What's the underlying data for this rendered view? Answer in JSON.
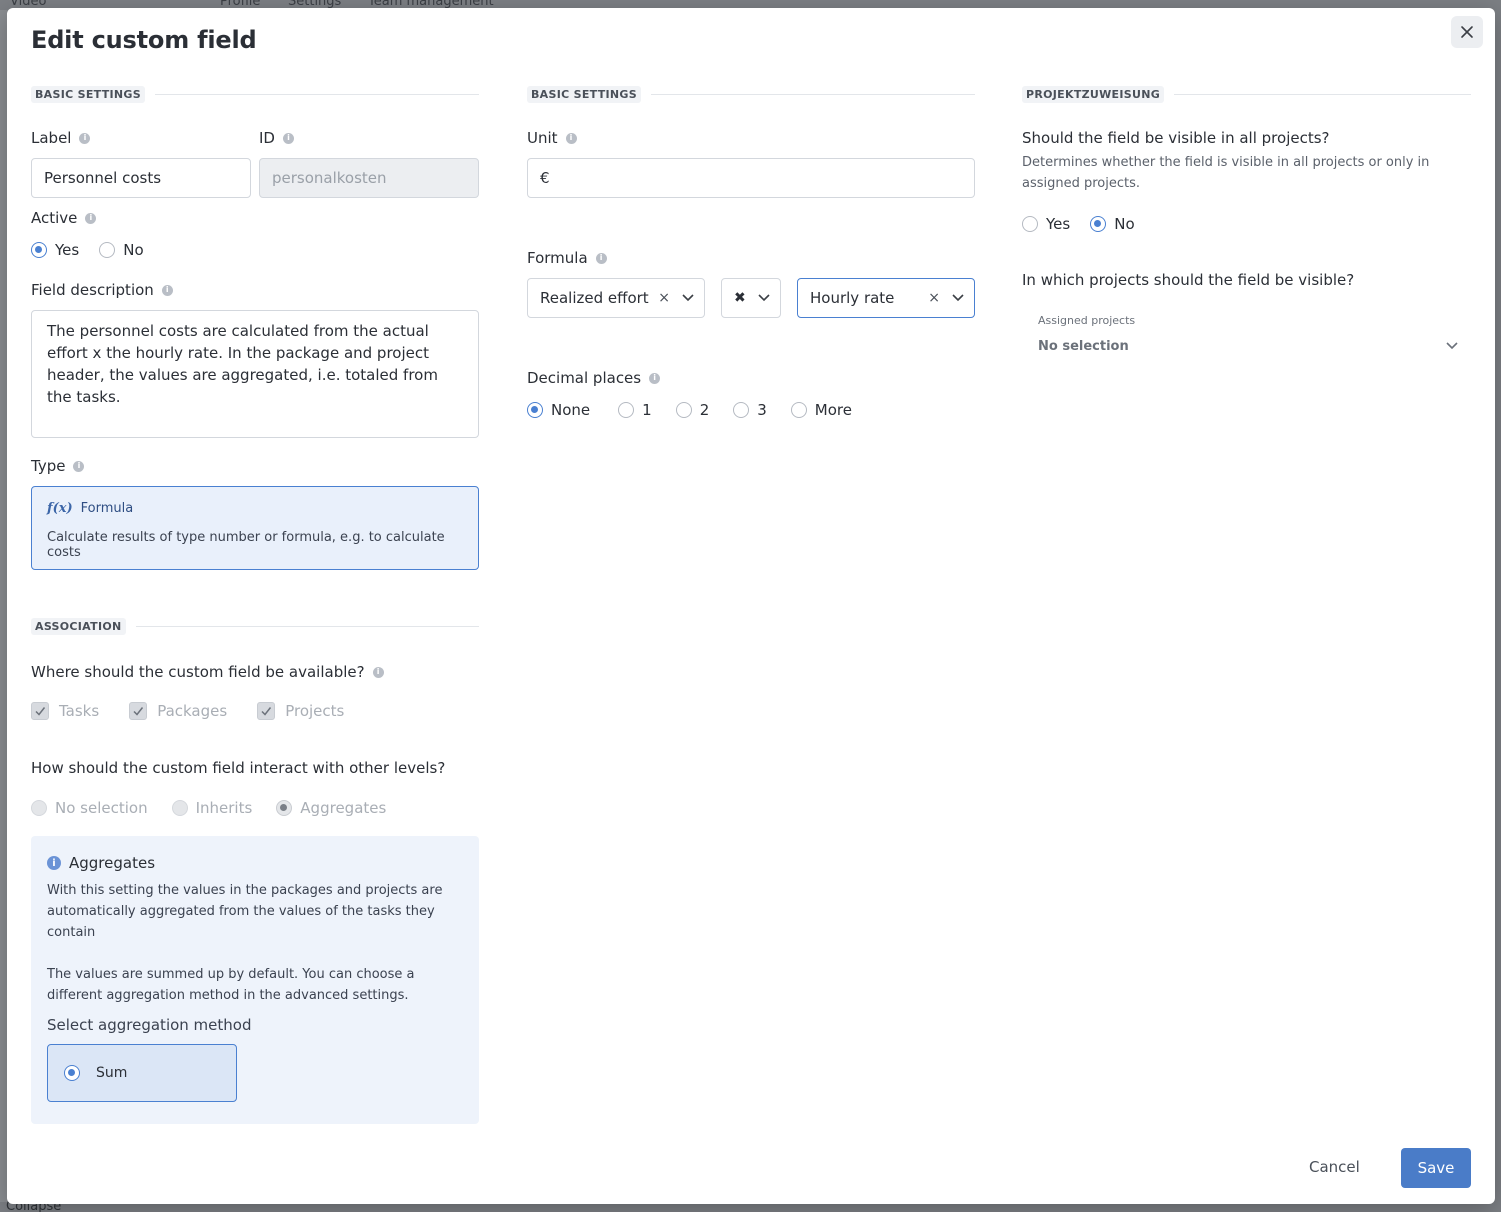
{
  "background": {
    "tabs": [
      "Video",
      "Profile",
      "Settings",
      "Team management"
    ],
    "collapse_label": "Collapse"
  },
  "modal": {
    "title": "Edit custom field",
    "close_icon": "close-icon"
  },
  "left": {
    "basic_settings_heading": "BASIC SETTINGS",
    "label_label": "Label",
    "label_value": "Personnel costs",
    "id_label": "ID",
    "id_value": "personalkosten",
    "active_label": "Active",
    "active_options": [
      "Yes",
      "No"
    ],
    "active_selected": "Yes",
    "description_label": "Field description",
    "description_value": "The personnel costs are calculated from the actual effort x the hourly rate. In the package and project header, the values are aggregated, i.e. totaled from the tasks.",
    "type_label": "Type",
    "type_icon": "f(x)",
    "type_name": "Formula",
    "type_description": "Calculate results of type number or formula, e.g. to calculate costs",
    "association_heading": "ASSOCIATION",
    "availability_question": "Where should the custom field be available?",
    "availability_options": [
      "Tasks",
      "Packages",
      "Projects"
    ],
    "interaction_question": "How should the custom field interact with other levels?",
    "interaction_options": [
      "No selection",
      "Inherits",
      "Aggregates"
    ],
    "interaction_selected": "Aggregates",
    "info_title": "Aggregates",
    "info_text_1": "With this setting the values in the packages and projects are automatically aggregated from the values of the tasks they contain",
    "info_text_2": "The values are summed up by default. You can choose a different aggregation method in the advanced settings.",
    "aggregation_method_label": "Select aggregation method",
    "aggregation_method_value": "Sum"
  },
  "middle": {
    "basic_settings_heading": "BASIC SETTINGS",
    "unit_label": "Unit",
    "unit_value": "€",
    "formula_label": "Formula",
    "formula_operand_1": "Realized effort",
    "formula_operator": "✖",
    "formula_operand_2": "Hourly rate",
    "decimal_label": "Decimal places",
    "decimal_options": [
      "None",
      "1",
      "2",
      "3",
      "More"
    ],
    "decimal_selected": "None"
  },
  "right": {
    "heading": "PROJEKTZUWEISUNG",
    "visible_question": "Should the field be visible in all projects?",
    "visible_hint": "Determines whether the field is visible in all projects or only in assigned projects.",
    "visible_options": [
      "Yes",
      "No"
    ],
    "visible_selected": "No",
    "which_projects_question": "In which projects should the field be visible?",
    "assigned_label": "Assigned projects",
    "assigned_value": "No selection"
  },
  "footer": {
    "cancel_label": "Cancel",
    "save_label": "Save"
  },
  "colors": {
    "accent": "#4a80d1",
    "save_button": "#4a7cc8",
    "type_card_bg": "#e9f0fb",
    "info_box_bg": "#eef3fb"
  }
}
